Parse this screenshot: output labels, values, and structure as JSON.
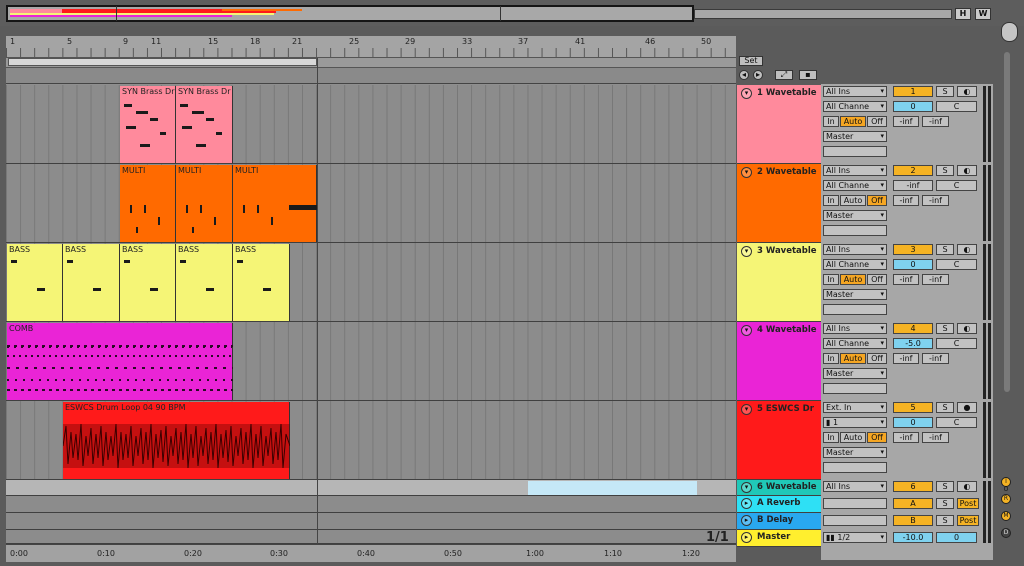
{
  "overview": {
    "h_label": "H",
    "w_label": "W"
  },
  "bar_numbers": [
    "1",
    "5",
    "9",
    "11",
    "15",
    "18",
    "21",
    "25",
    "29",
    "33",
    "37",
    "41",
    "46",
    "50"
  ],
  "time_labels": [
    "0:00",
    "0:10",
    "0:20",
    "0:30",
    "0:40",
    "0:50",
    "1:00",
    "1:10",
    "1:20"
  ],
  "page_indicator": "1/1",
  "set_label": "Set",
  "clips": {
    "syn1": "SYN Brass Dr",
    "syn2": "SYN Brass Dr",
    "multi1": "MULTI",
    "multi2": "MULTI",
    "multi3": "MULTI",
    "bass1": "BASS",
    "bass2": "BASS",
    "bass3": "BASS",
    "bass4": "BASS",
    "bass5": "BASS",
    "comb": "COMB",
    "drum": "ESWCS Drum Loop 04 90 BPM"
  },
  "tracks": [
    {
      "name": "1 Wavetable",
      "color": "#ff8a9c",
      "input": "All Ins",
      "channel": "All Channe",
      "mon_in": "In",
      "mon_auto": "Auto",
      "mon_off": "Off",
      "output": "Master",
      "number": "1",
      "solo": "S",
      "volume": "0",
      "pan": "C",
      "send_a": "-inf",
      "send_b": "-inf"
    },
    {
      "name": "2 Wavetable",
      "color": "#ff6a00",
      "input": "All Ins",
      "channel": "All Channe",
      "mon_in": "In",
      "mon_auto": "Auto",
      "mon_off": "Off",
      "output": "Master",
      "number": "2",
      "solo": "S",
      "volume": "-inf",
      "pan": "C",
      "send_a": "-inf",
      "send_b": "-inf"
    },
    {
      "name": "3 Wavetable",
      "color": "#f5f576",
      "input": "All Ins",
      "channel": "All Channe",
      "mon_in": "In",
      "mon_auto": "Auto",
      "mon_off": "Off",
      "output": "Master",
      "number": "3",
      "solo": "S",
      "volume": "0",
      "pan": "C",
      "send_a": "-inf",
      "send_b": "-inf"
    },
    {
      "name": "4 Wavetable",
      "color": "#ea24d6",
      "input": "All Ins",
      "channel": "All Channe",
      "mon_in": "In",
      "mon_auto": "Auto",
      "mon_off": "Off",
      "output": "Master",
      "number": "4",
      "solo": "S",
      "volume": "-5.0",
      "pan": "C",
      "send_a": "-inf",
      "send_b": "-inf"
    },
    {
      "name": "5 ESWCS Dr",
      "color": "#ff1a1a",
      "input": "Ext. In",
      "channel": "1",
      "mon_in": "In",
      "mon_auto": "Auto",
      "mon_off": "Off",
      "output": "Master",
      "number": "5",
      "solo": "S",
      "volume": "0",
      "pan": "C",
      "send_a": "-inf",
      "send_b": "-inf"
    },
    {
      "name": "6 Wavetable",
      "color": "#20c8b8",
      "input": "All Ins",
      "number": "6",
      "solo": "S"
    }
  ],
  "returns": [
    {
      "name": "A Reverb",
      "color": "#2ee0f5",
      "letter": "A",
      "solo": "S",
      "post": "Post"
    },
    {
      "name": "B Delay",
      "color": "#29a8f0",
      "letter": "B",
      "solo": "S",
      "post": "Post"
    }
  ],
  "master": {
    "name": "Master",
    "color": "#ffef2e",
    "cue": "1/2",
    "volume": "-10.0",
    "pan": "0"
  },
  "side_buttons": [
    "I O",
    "R",
    "M",
    "D"
  ]
}
